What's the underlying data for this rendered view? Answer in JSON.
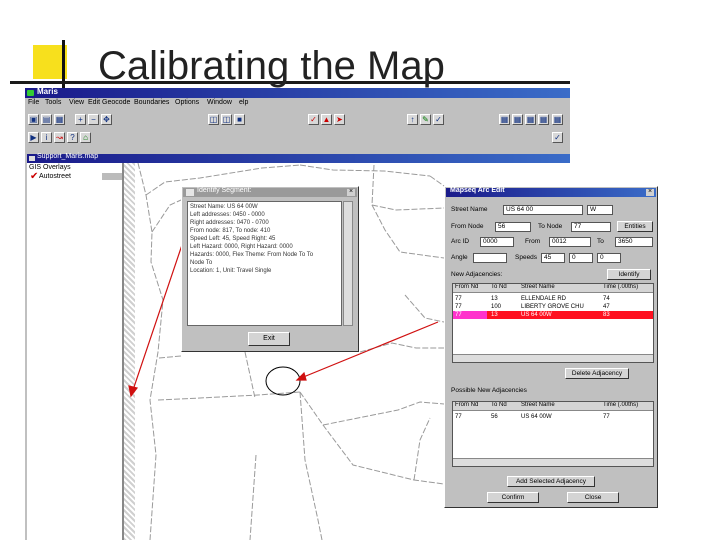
{
  "slide": {
    "title": "Calibrating the Map"
  },
  "app": {
    "title": "Maris",
    "menu": [
      "File",
      "Tools",
      "View",
      "Edit Geocode",
      "Boundaries",
      "Options",
      "Window",
      "elp"
    ]
  },
  "map_window": {
    "title": "Support_Maris.map",
    "gis_label": "GIS Overlays",
    "layer": "Autostreet"
  },
  "identify_dialog": {
    "title": "Identify Segment:",
    "lines": [
      "Street Name: US 64 00W",
      "Left addresses: 0450 - 0000",
      "Right addresses: 0470 - 0700",
      "From node: 817, To node: 410",
      "Speed Left: 45, Speed Right: 45",
      "Left Hazard: 0000, Right Hazard: 0000",
      "Hazards: 0000, Flex Theme: From Node To To",
      "Node To",
      "Location: 1, Unit: Travel Single"
    ],
    "exit_label": "Exit"
  },
  "arc_dialog": {
    "title": "Mapseq Arc Edit",
    "street_name_label": "Street Name",
    "street_name": "US 64 00",
    "street_suffix": "W",
    "from_node_label": "From Node",
    "from_node": "56",
    "to_node_label": "To Node",
    "to_node": "77",
    "entities_button": "Entities",
    "arc_id_label": "Arc ID",
    "arc_id": "0000",
    "from_label": "From",
    "from_value": "0012",
    "to_label": "To",
    "to_value": "3650",
    "angle_label": "Angle",
    "speeds_label": "Speeds",
    "speeds": [
      "45",
      "0",
      "0"
    ],
    "new_adj_label": "New Adjacencies:",
    "identify_button": "Identify",
    "columns": [
      "From Nd",
      "To Nd",
      "Street Name",
      "Time (.00ths)"
    ],
    "adjacencies": [
      {
        "from": "77",
        "to": "13",
        "street": "ELLENDALE RD",
        "time": "74"
      },
      {
        "from": "77",
        "to": "100",
        "street": "LIBERTY GROVE CHU",
        "time": "47"
      },
      {
        "from": "77",
        "to": "13",
        "street": "US 64 00W",
        "time": "83"
      }
    ],
    "delete_button": "Delete Adjacency",
    "possible_label": "Possible New Adjacencies",
    "possible": [
      {
        "from": "77",
        "to": "56",
        "street": "US 64 00W",
        "time": "77"
      }
    ],
    "add_button": "Add Selected Adjacency",
    "confirm_button": "Confirm",
    "close_button": "Close"
  },
  "colors": {
    "titlebar_dark": "#1a1a8a",
    "titlebar_light": "#3a6cc8",
    "selected_row": "#ff1020",
    "selected_cell": "#ff33cc",
    "accent_yellow": "#f7e01d",
    "arrow": "#d01010"
  }
}
